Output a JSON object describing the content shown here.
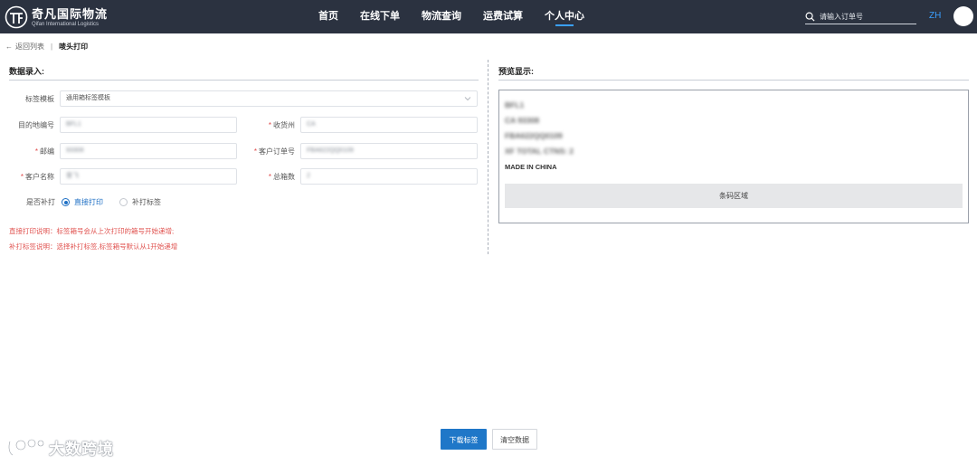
{
  "brand": {
    "name_cn": "奇凡国际物流",
    "name_en": "Qifan International Logistics"
  },
  "nav": [
    {
      "label": "首页",
      "active": false
    },
    {
      "label": "在线下单",
      "active": false
    },
    {
      "label": "物流查询",
      "active": false
    },
    {
      "label": "运费试算",
      "active": false
    },
    {
      "label": "个人中心",
      "active": true
    }
  ],
  "search": {
    "placeholder": "请输入订单号"
  },
  "lang": "ZH",
  "breadcrumb": {
    "back": "返回列表",
    "separator": "|",
    "current": "唛头打印"
  },
  "data_entry": {
    "title": "数据录入:",
    "template": {
      "label": "标签模板",
      "value": "通用箱标签模板"
    },
    "dest_code": {
      "label": "目的地编号",
      "value": "BFL1"
    },
    "state": {
      "label": "收货州",
      "value": "CA"
    },
    "zip": {
      "label": "邮编",
      "value": "93308"
    },
    "order_no": {
      "label": "客户订单号",
      "value": "FBA622QQ0109"
    },
    "customer": {
      "label": "客户名称",
      "value": "曾飞"
    },
    "boxes": {
      "label": "总箱数",
      "value": "2"
    },
    "reprint": {
      "label": "是否补打",
      "options": [
        {
          "label": "直接打印",
          "selected": true
        },
        {
          "label": "补打标签",
          "selected": false
        }
      ]
    },
    "notes": [
      "直接打印说明：标签箱号会从上次打印的箱号开始递增;",
      "补打标签说明：选择补打标签,标签箱号默认从1开始递增"
    ]
  },
  "preview": {
    "title": "预览显示:",
    "lines": [
      "BFL1",
      "CA 93308",
      "FBA622QQ0109",
      "XF TOTAL CTNS: 2"
    ],
    "made_in": "MADE IN CHINA",
    "barcode_label": "条码区域"
  },
  "actions": {
    "download": "下载标签",
    "clear": "清空数据"
  },
  "watermark": "大数跨境",
  "colors": {
    "header_bg": "#2b3240",
    "accent": "#1f77c8",
    "note_red": "#e0524f"
  }
}
